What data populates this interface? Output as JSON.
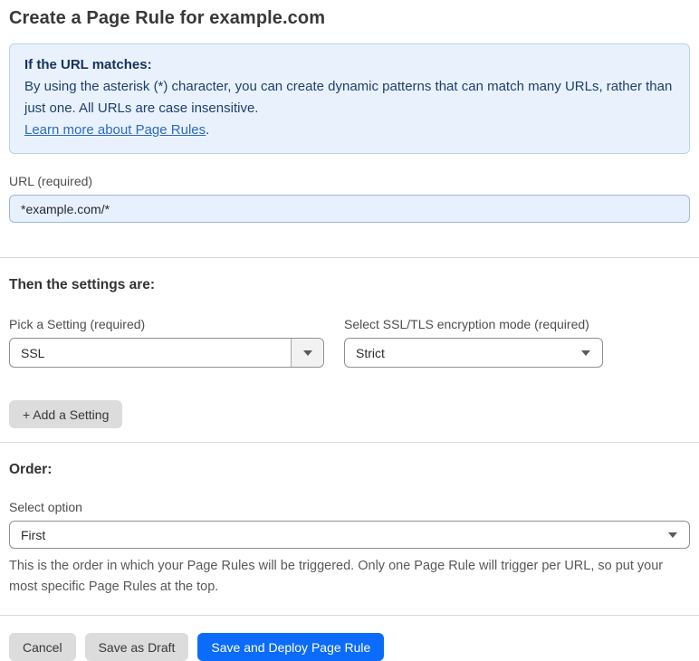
{
  "page": {
    "title": "Create a Page Rule for example.com"
  },
  "info_box": {
    "heading": "If the URL matches:",
    "body": "By using the asterisk (*) character, you can create dynamic patterns that can match many URLs, rather than just one. All URLs are case insensitive.",
    "link_text": "Learn more about Page Rules",
    "link_suffix": "."
  },
  "url_field": {
    "label": "URL (required)",
    "value": "*example.com/*"
  },
  "settings_section": {
    "heading": "Then the settings are:",
    "setting_picker": {
      "label": "Pick a Setting (required)",
      "value": "SSL"
    },
    "mode_picker": {
      "label": "Select SSL/TLS encryption mode (required)",
      "value": "Strict"
    },
    "add_button_label": "+ Add a Setting"
  },
  "order_section": {
    "heading": "Order:",
    "label": "Select option",
    "value": "First",
    "help_text": "This is the order in which your Page Rules will be triggered. Only one Page Rule will trigger per URL, so put your most specific Page Rules at the top."
  },
  "footer": {
    "cancel_label": "Cancel",
    "save_draft_label": "Save as Draft",
    "save_deploy_label": "Save and Deploy Page Rule"
  },
  "icons": {
    "caret_down": "caret-down-icon"
  },
  "colors": {
    "accent_blue": "#0b6cfb",
    "info_bg": "#e9f2fc",
    "info_border": "#b5d2ef",
    "info_text": "#1e3f70",
    "info_heading_text": "#16325c",
    "link_blue": "#2b6bc4",
    "url_input_bg": "#e7f0fd",
    "url_input_border": "#9db9de",
    "gray_button_bg": "#dcdcdc",
    "divider": "#d8d8d8"
  }
}
